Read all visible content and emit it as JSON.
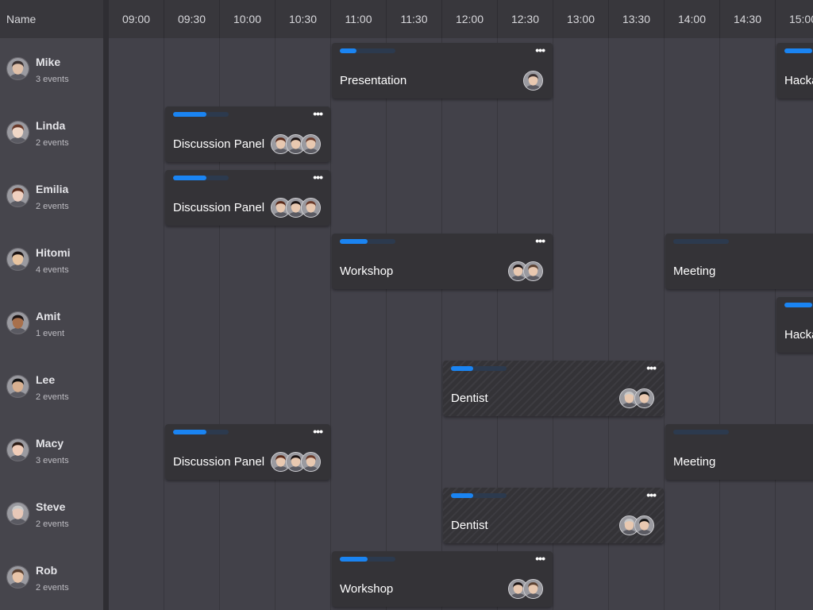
{
  "header": {
    "name_label": "Name",
    "ticks": [
      "09:00",
      "09:30",
      "10:00",
      "10:30",
      "11:00",
      "11:30",
      "12:00",
      "12:30",
      "13:00",
      "13:30",
      "14:00",
      "14:30",
      "15:00"
    ]
  },
  "resources": [
    {
      "name": "Mike",
      "count": "3 events",
      "skin": "#e0c0a8",
      "hair": "#3a3030"
    },
    {
      "name": "Linda",
      "count": "2 events",
      "skin": "#f0d8c8",
      "hair": "#6a3a2a"
    },
    {
      "name": "Emilia",
      "count": "2 events",
      "skin": "#f0d0c0",
      "hair": "#5a2a1a"
    },
    {
      "name": "Hitomi",
      "count": "4 events",
      "skin": "#e8c4a0",
      "hair": "#1a1212"
    },
    {
      "name": "Amit",
      "count": "1 event",
      "skin": "#a8704c",
      "hair": "#1a1212"
    },
    {
      "name": "Lee",
      "count": "2 events",
      "skin": "#d8b090",
      "hair": "#111111"
    },
    {
      "name": "Macy",
      "count": "3 events",
      "skin": "#f0ccb8",
      "hair": "#2a1a14"
    },
    {
      "name": "Steve",
      "count": "2 events",
      "skin": "#e8c8b8",
      "hair": "#c8c8c8"
    },
    {
      "name": "Rob",
      "count": "2 events",
      "skin": "#e8c4a8",
      "hair": "#5a4030"
    }
  ],
  "events": [
    {
      "row": 0,
      "start": 4,
      "span": 4,
      "title": "Presentation",
      "progress": 0.3,
      "striped": false,
      "avatars": [
        "#3a3030"
      ]
    },
    {
      "row": 0,
      "start": 12,
      "span": 4,
      "title": "Hackathon",
      "progress": 0.5,
      "striped": false,
      "avatars": []
    },
    {
      "row": 1,
      "start": 1,
      "span": 3,
      "title": "Discussion Panel",
      "progress": 0.6,
      "striped": false,
      "avatars": [
        "#5a2a1a",
        "#1a1212",
        "#6a3a2a"
      ]
    },
    {
      "row": 2,
      "start": 1,
      "span": 3,
      "title": "Discussion Panel",
      "progress": 0.6,
      "striped": false,
      "avatars": [
        "#5a2a1a",
        "#1a1212",
        "#6a3a2a"
      ]
    },
    {
      "row": 3,
      "start": 4,
      "span": 4,
      "title": "Workshop",
      "progress": 0.5,
      "striped": false,
      "avatars": [
        "#1a1212",
        "#5a4030"
      ]
    },
    {
      "row": 3,
      "start": 10,
      "span": 4,
      "title": "Meeting",
      "progress": 0.0,
      "striped": false,
      "avatars": []
    },
    {
      "row": 4,
      "start": 12,
      "span": 4,
      "title": "Hackathon",
      "progress": 0.5,
      "striped": false,
      "avatars": []
    },
    {
      "row": 5,
      "start": 6,
      "span": 4,
      "title": "Dentist",
      "progress": 0.4,
      "striped": true,
      "avatars": [
        "#c8c8c8",
        "#111111"
      ]
    },
    {
      "row": 6,
      "start": 1,
      "span": 3,
      "title": "Discussion Panel",
      "progress": 0.6,
      "striped": false,
      "avatars": [
        "#5a2a1a",
        "#1a1212",
        "#6a3a2a"
      ]
    },
    {
      "row": 6,
      "start": 10,
      "span": 4,
      "title": "Meeting",
      "progress": 0.0,
      "striped": false,
      "avatars": []
    },
    {
      "row": 7,
      "start": 6,
      "span": 4,
      "title": "Dentist",
      "progress": 0.4,
      "striped": true,
      "avatars": [
        "#c8c8c8",
        "#111111"
      ]
    },
    {
      "row": 8,
      "start": 4,
      "span": 4,
      "title": "Workshop",
      "progress": 0.5,
      "striped": false,
      "avatars": [
        "#1a1212",
        "#5a4030"
      ]
    }
  ],
  "colors": {
    "accent": "#1a84f2",
    "track": "#2c3a4e",
    "event_bg": "#343337"
  },
  "icons": {
    "event_menu": "more-horizontal-icon"
  }
}
